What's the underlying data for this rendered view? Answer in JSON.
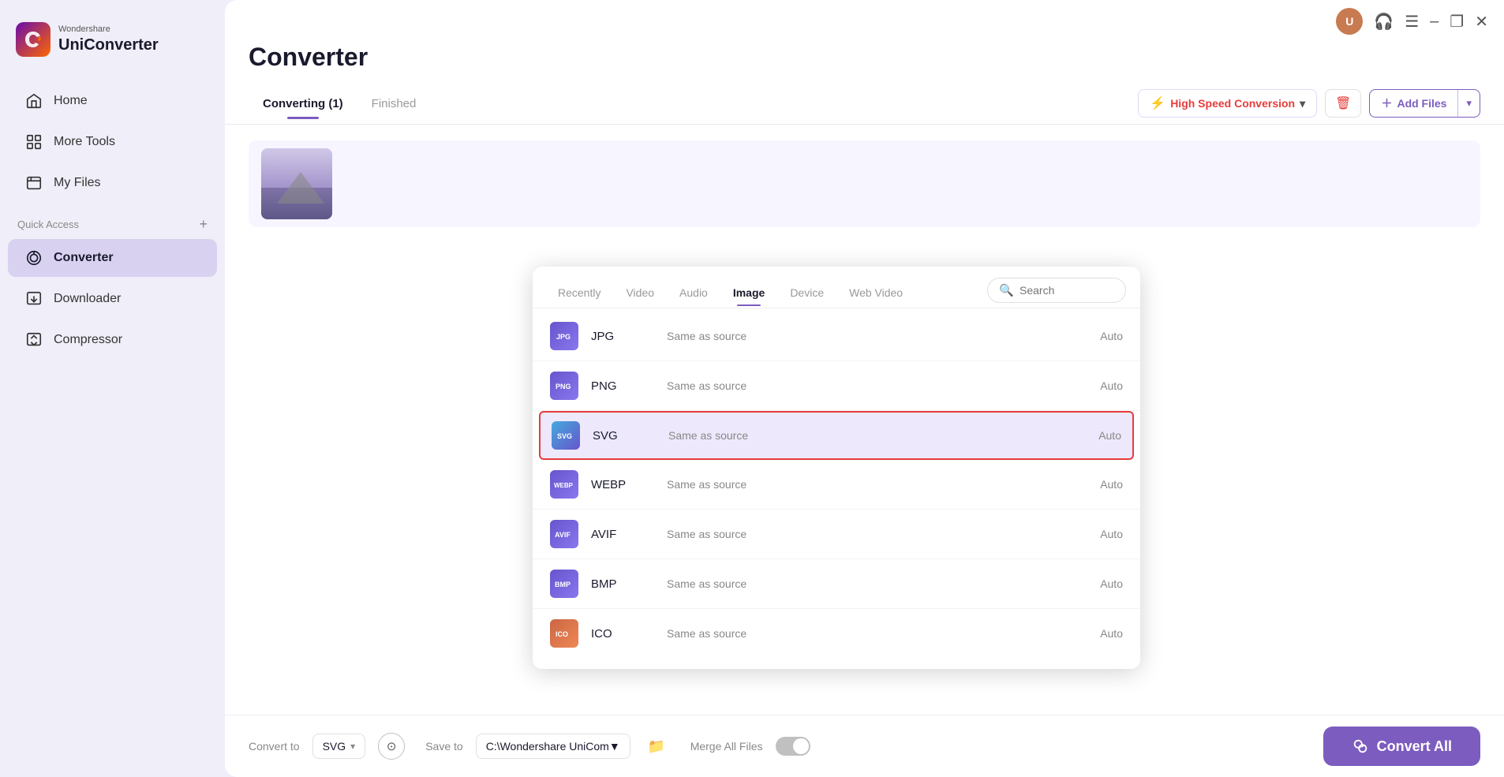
{
  "app": {
    "brand": "Wondershare",
    "name": "UniConverter"
  },
  "sidebar": {
    "items": [
      {
        "id": "home",
        "label": "Home"
      },
      {
        "id": "more-tools",
        "label": "More Tools"
      },
      {
        "id": "my-files",
        "label": "My Files"
      }
    ],
    "quick_access_label": "Quick Access",
    "active_item": {
      "id": "converter",
      "label": "Converter"
    },
    "extra_items": [
      {
        "id": "downloader",
        "label": "Downloader"
      },
      {
        "id": "compressor",
        "label": "Compressor"
      }
    ]
  },
  "page": {
    "title": "Converter",
    "tabs": [
      {
        "id": "converting",
        "label": "Converting (1)",
        "active": true
      },
      {
        "id": "finished",
        "label": "Finished",
        "active": false
      }
    ]
  },
  "toolbar": {
    "speed_label": "High Speed Conversion",
    "delete_icon": "trash",
    "add_files_label": "Add Files"
  },
  "format_panel": {
    "tabs": [
      {
        "id": "recently",
        "label": "Recently",
        "active": false
      },
      {
        "id": "video",
        "label": "Video",
        "active": false
      },
      {
        "id": "audio",
        "label": "Audio",
        "active": false
      },
      {
        "id": "image",
        "label": "Image",
        "active": true
      },
      {
        "id": "device",
        "label": "Device",
        "active": false
      },
      {
        "id": "web-video",
        "label": "Web Video",
        "active": false
      }
    ],
    "search_placeholder": "Search",
    "formats": [
      {
        "id": "jpg",
        "name": "JPG",
        "quality": "Same as source",
        "size": "Auto",
        "selected": false
      },
      {
        "id": "png",
        "name": "PNG",
        "quality": "Same as source",
        "size": "Auto",
        "selected": false
      },
      {
        "id": "svg",
        "name": "SVG",
        "quality": "Same as source",
        "size": "Auto",
        "selected": true
      },
      {
        "id": "webp",
        "name": "WEBP",
        "quality": "Same as source",
        "size": "Auto",
        "selected": false
      },
      {
        "id": "avif",
        "name": "AVIF",
        "quality": "Same as source",
        "size": "Auto",
        "selected": false
      },
      {
        "id": "bmp",
        "name": "BMP",
        "quality": "Same as source",
        "size": "Auto",
        "selected": false
      },
      {
        "id": "ico",
        "name": "ICO",
        "quality": "Same as source",
        "size": "Auto",
        "selected": false
      }
    ]
  },
  "bottom_bar": {
    "convert_to_label": "Convert to",
    "convert_to_value": "SVG",
    "save_to_label": "Save to",
    "save_to_path": "C:\\Wondershare UniCom▼",
    "merge_label": "Merge All Files",
    "convert_all_label": "Convert All"
  },
  "colors": {
    "accent": "#7c5cbf",
    "danger": "#e63c3c",
    "selected_bg": "#ede8fb",
    "sidebar_bg": "#f0eef8"
  }
}
